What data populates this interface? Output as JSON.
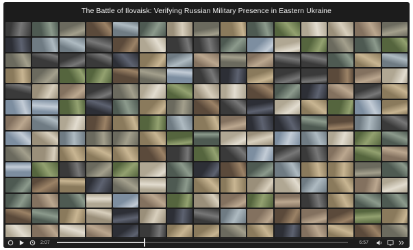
{
  "player": {
    "title": "The Battle of Ilovaisk: Verifying Russian Military Presence in Eastern Ukraine",
    "controls": {
      "current_time": "2:07",
      "total_time": "6:57",
      "progress": 0.3,
      "icons": [
        "replay-icon",
        "play-icon",
        "rewind-icon",
        "volume-icon",
        "screen-icon",
        "chapters-icon"
      ]
    },
    "grid": {
      "columns": 15,
      "rows": 14
    }
  }
}
